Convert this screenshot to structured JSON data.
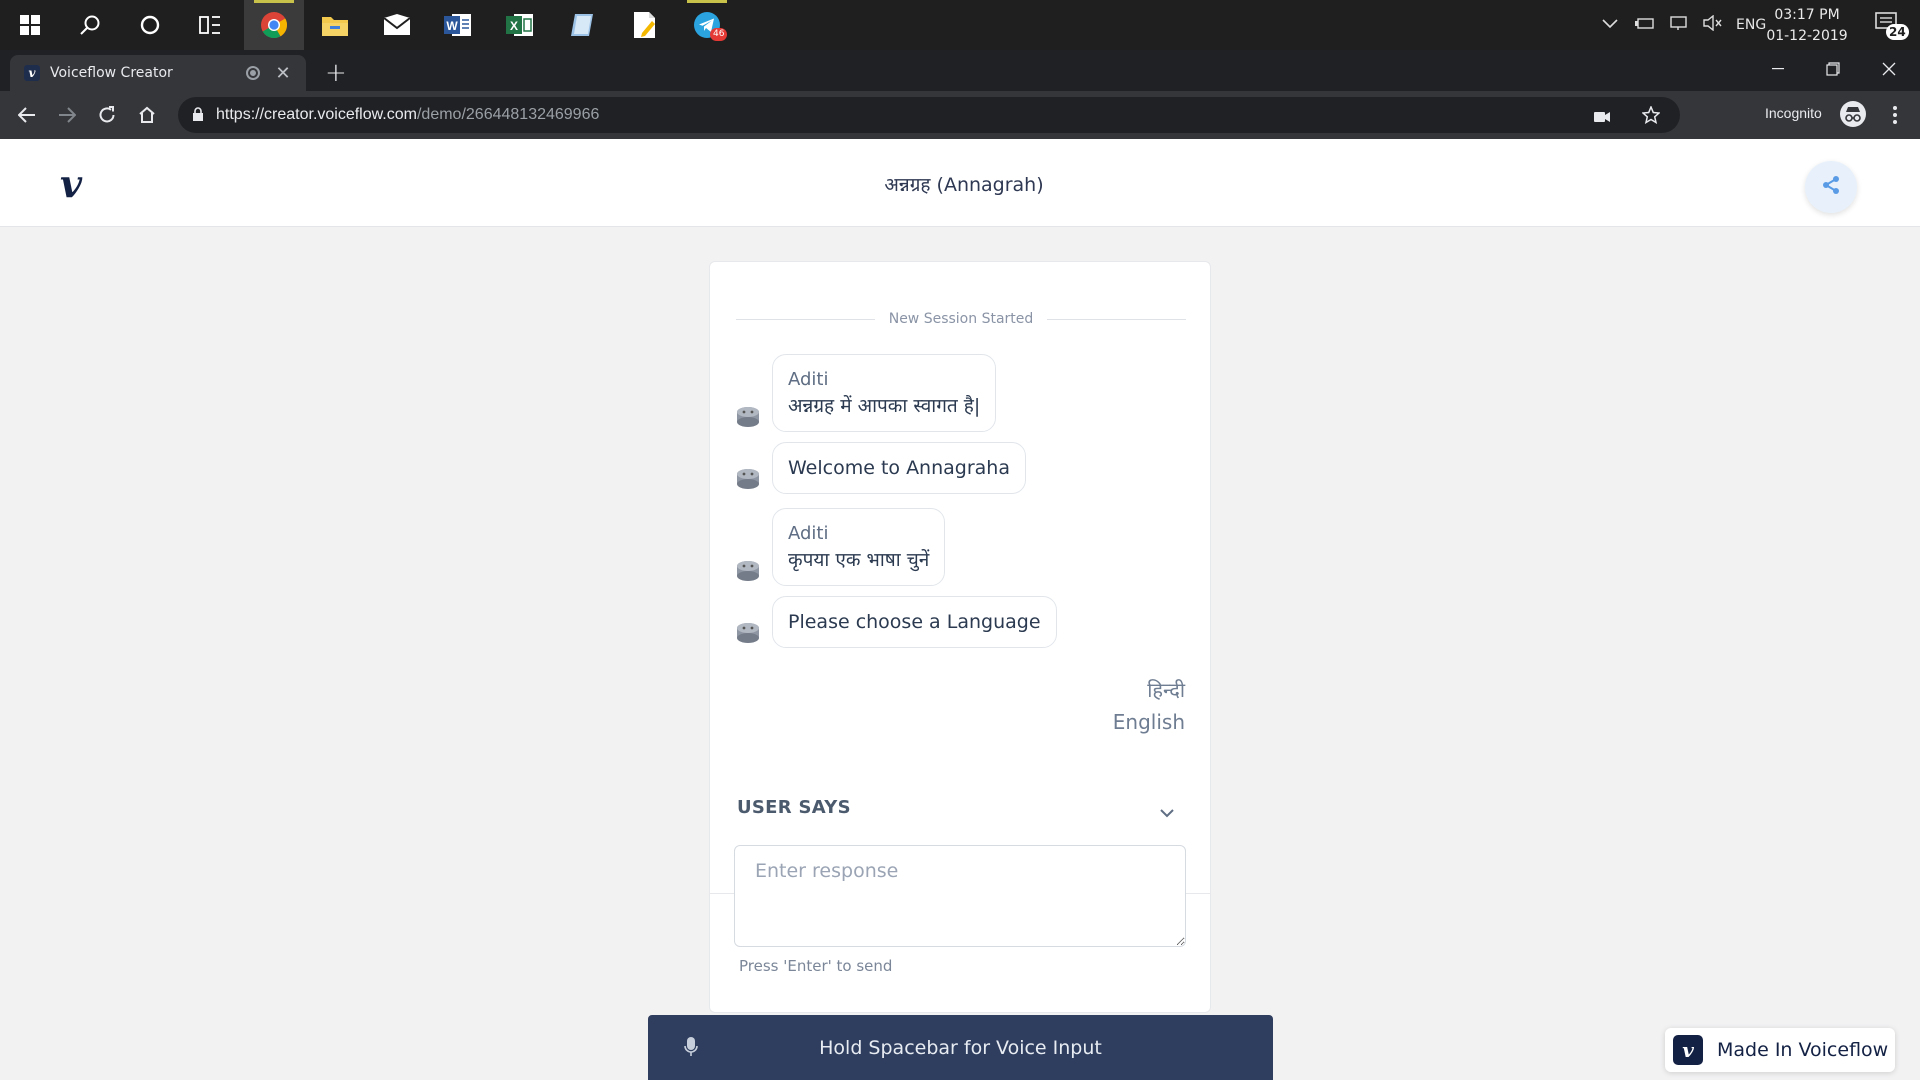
{
  "taskbar": {
    "apps": [
      "start-icon",
      "search-icon",
      "cortana-icon",
      "task-view-icon",
      "chrome-icon",
      "file-explorer-icon",
      "mail-icon",
      "word-icon",
      "excel-icon",
      "notes-icon",
      "editor-icon",
      "telegram-icon"
    ],
    "telegram_badge": "46",
    "language": "ENG",
    "time": "03:17 PM",
    "date": "01-12-2019",
    "notification_count": "24"
  },
  "browser": {
    "tab_title": "Voiceflow Creator",
    "url_host": "https://creator.voiceflow.com",
    "url_path": "/demo/266448132469966",
    "incognito_label": "Incognito"
  },
  "header": {
    "logo": "v",
    "project_title": "अन्नग्रह (Annagrah)"
  },
  "conversation": {
    "session_label": "New Session Started",
    "messages": [
      {
        "speaker": "Aditi",
        "text": "अन्नग्रह में आपका स्वागत है|"
      },
      {
        "speaker": "",
        "text": "Welcome to Annagraha"
      },
      {
        "speaker": "Aditi",
        "text": "कृपया एक भाषा चुनें"
      },
      {
        "speaker": "",
        "text": "Please choose a Language"
      }
    ],
    "choices": [
      "हिन्दी",
      "English"
    ]
  },
  "input": {
    "section_label": "USER SAYS",
    "placeholder": "Enter response",
    "hint": "Press 'Enter' to send"
  },
  "voice": {
    "label": "Hold Spacebar for Voice Input"
  },
  "badge": {
    "label": "Made In Voiceflow"
  },
  "colors": {
    "brand_navy": "#132144",
    "voice_bar": "#2f3e5e",
    "page_bg": "#f2f2f3",
    "share_accent": "#5a9be6"
  }
}
